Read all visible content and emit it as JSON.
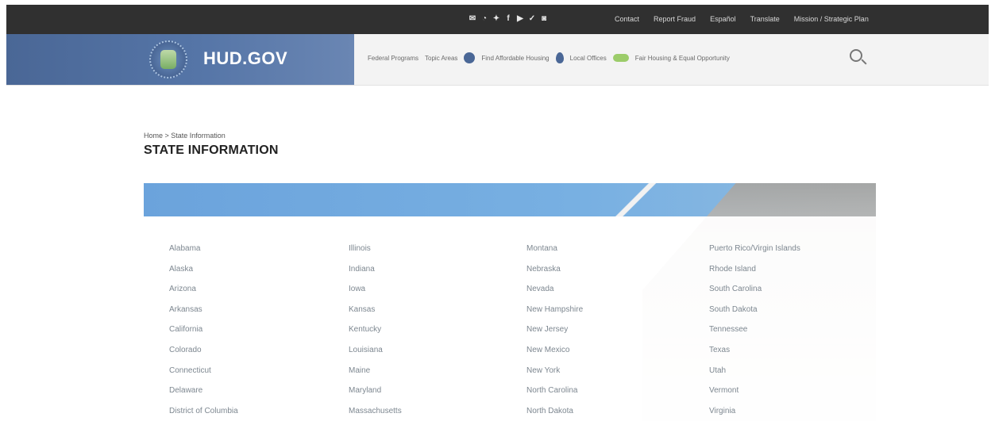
{
  "utility_nav": {
    "social_icons": [
      "email-icon",
      "rss-icon",
      "newsletter-icon",
      "facebook-icon",
      "youtube-icon",
      "twitter-icon",
      "instagram-icon"
    ],
    "links": [
      "Contact",
      "Report Fraud",
      "Español",
      "Translate",
      "Mission / Strategic Plan"
    ]
  },
  "header": {
    "site_name": "HUD.GOV",
    "nav": [
      {
        "label": "Federal Programs",
        "icon": ""
      },
      {
        "label": "Topic Areas",
        "icon": ""
      },
      {
        "label": "Find Affordable Housing",
        "icon": "home-icon"
      },
      {
        "label": "Local Offices",
        "icon": "map-pin-icon"
      },
      {
        "label": "Fair Housing & Equal Opportunity",
        "icon": "badge-icon"
      }
    ]
  },
  "breadcrumb": "Home > State Information",
  "page_title": "STATE INFORMATION",
  "states": [
    [
      "Alabama",
      "Illinois",
      "Montana",
      "Puerto Rico/Virgin Islands"
    ],
    [
      "Alaska",
      "Indiana",
      "Nebraska",
      "Rhode Island"
    ],
    [
      "Arizona",
      "Iowa",
      "Nevada",
      "South Carolina"
    ],
    [
      "Arkansas",
      "Kansas",
      "New Hampshire",
      "South Dakota"
    ],
    [
      "California",
      "Kentucky",
      "New Jersey",
      "Tennessee"
    ],
    [
      "Colorado",
      "Louisiana",
      "New Mexico",
      "Texas"
    ],
    [
      "Connecticut",
      "Maine",
      "New York",
      "Utah"
    ],
    [
      "Delaware",
      "Maryland",
      "North Carolina",
      "Vermont"
    ],
    [
      "District of Columbia",
      "Massachusetts",
      "North Dakota",
      "Virginia"
    ]
  ]
}
